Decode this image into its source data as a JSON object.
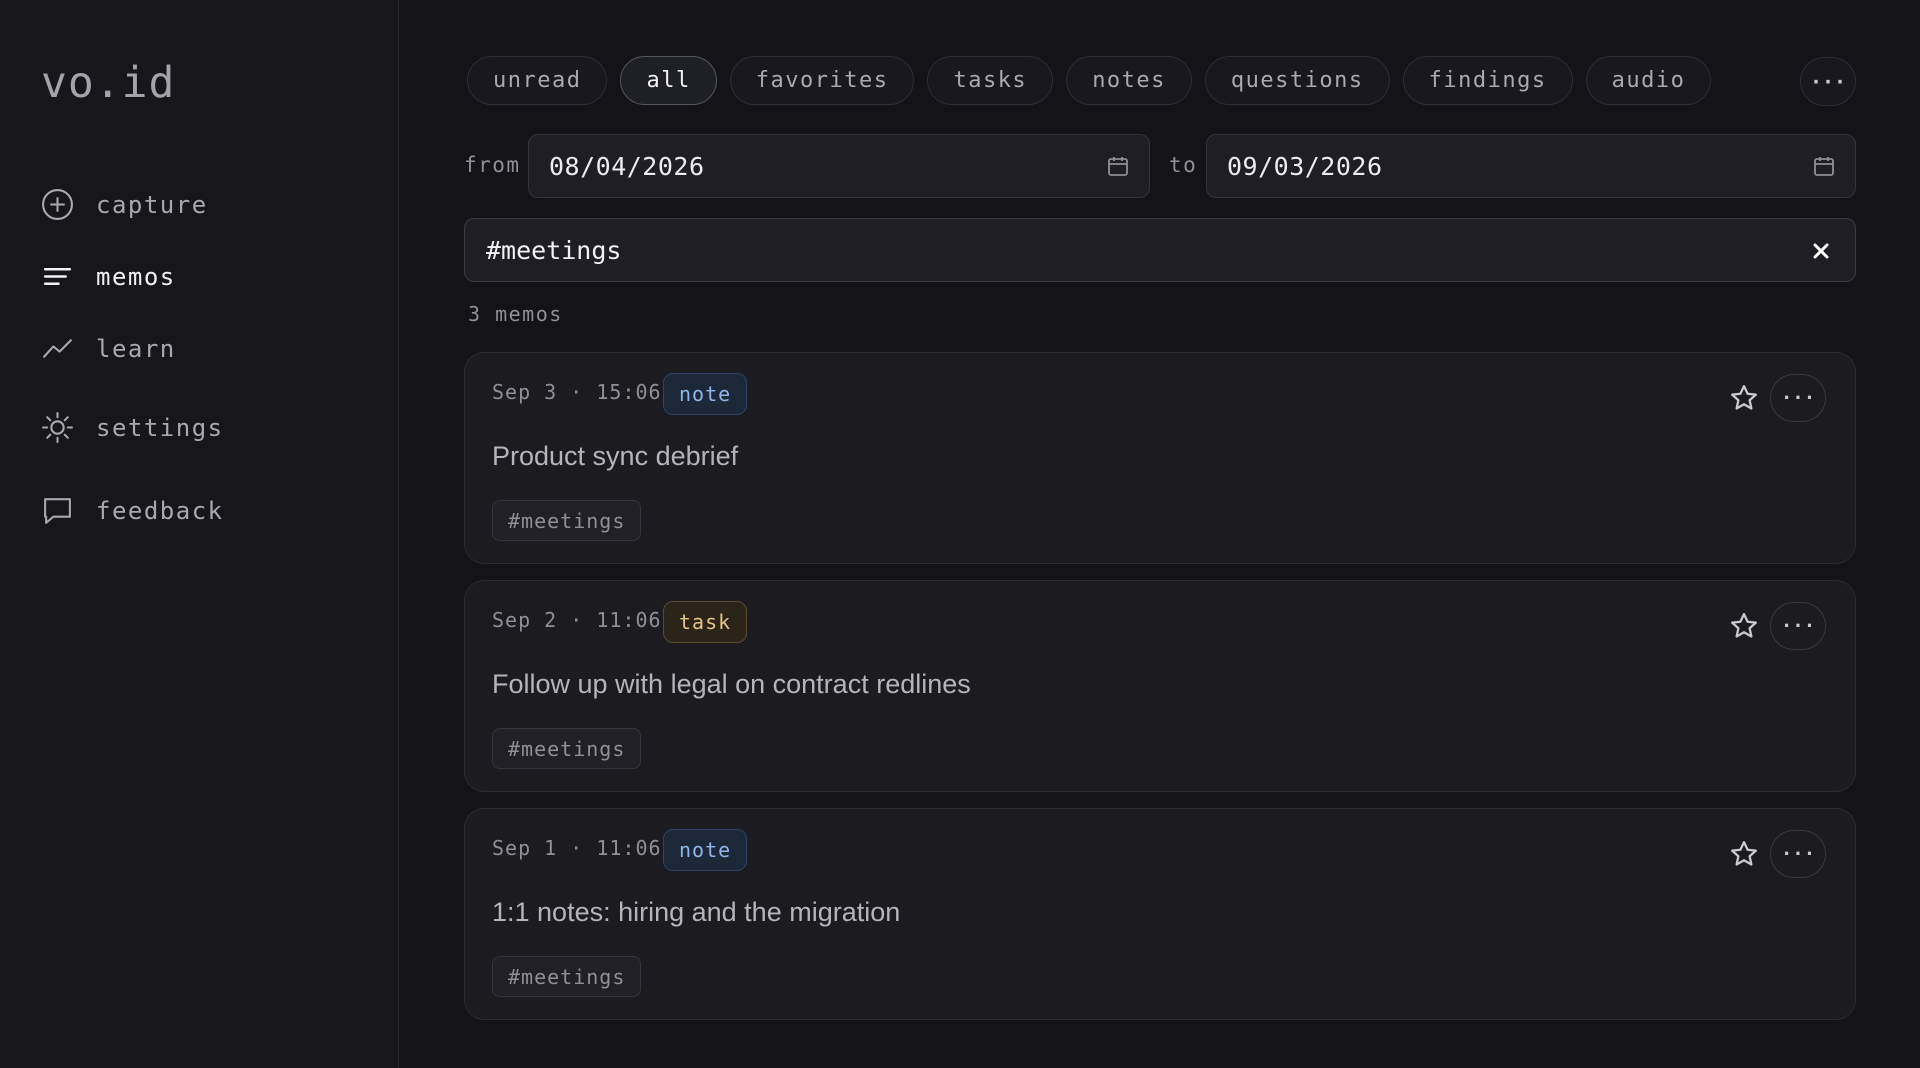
{
  "app": {
    "logo": "vo.id"
  },
  "sidebar": {
    "items": [
      {
        "label": "capture",
        "icon": "plus-circle-icon"
      },
      {
        "label": "memos",
        "icon": "list-lines-icon",
        "active": true
      },
      {
        "label": "learn",
        "icon": "trend-line-icon"
      },
      {
        "label": "settings",
        "icon": "sun-gear-icon"
      },
      {
        "label": "feedback",
        "icon": "chat-bubble-icon"
      }
    ]
  },
  "filters": {
    "chips": [
      "unread",
      "all",
      "favorites",
      "tasks",
      "notes",
      "questions",
      "findings",
      "audio"
    ],
    "active": "all",
    "more_label": "···"
  },
  "date_range": {
    "from_label": "from",
    "from_value": "08/04/2026",
    "to_label": "to",
    "to_value": "09/03/2026"
  },
  "search": {
    "value": "#meetings"
  },
  "results": {
    "count_text": "3 memos"
  },
  "memos": [
    {
      "date": "Sep 3 · 15:06",
      "type": "note",
      "title": "Product sync debrief",
      "tag": "#meetings"
    },
    {
      "date": "Sep 2 · 11:06",
      "type": "task",
      "title": "Follow up with legal on contract redlines",
      "tag": "#meetings"
    },
    {
      "date": "Sep 1 · 11:06",
      "type": "note",
      "title": "1:1 notes: hiring and the migration",
      "tag": "#meetings"
    }
  ],
  "colors": {
    "background": "#131318",
    "note_badge": "#8fb6ea",
    "task_badge": "#e5c487"
  }
}
